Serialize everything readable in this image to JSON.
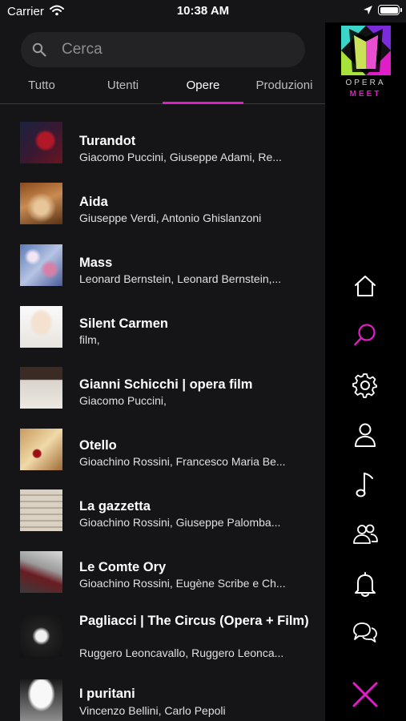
{
  "status_bar": {
    "carrier": "Carrier",
    "time": "10:38 AM"
  },
  "search": {
    "placeholder": "Cerca"
  },
  "tabs": [
    {
      "label": "Tutto"
    },
    {
      "label": "Utenti"
    },
    {
      "label": "Opere",
      "selected": true
    },
    {
      "label": "Produzioni"
    }
  ],
  "results": [
    {
      "title": "Turandot",
      "subtitle": "Giacomo Puccini, Giuseppe Adami, Re..."
    },
    {
      "title": "Aida",
      "subtitle": "Giuseppe Verdi, Antonio Ghislanzoni"
    },
    {
      "title": "Mass",
      "subtitle": "Leonard Bernstein, Leonard Bernstein,..."
    },
    {
      "title": "Silent Carmen",
      "subtitle": "film,"
    },
    {
      "title": "Gianni Schicchi | opera film",
      "subtitle": "Giacomo Puccini,"
    },
    {
      "title": "Otello",
      "subtitle": "Gioachino Rossini, Francesco Maria Be..."
    },
    {
      "title": "La gazzetta",
      "subtitle": "Gioachino Rossini, Giuseppe Palomba..."
    },
    {
      "title": "Le Comte Ory",
      "subtitle": "Gioachino Rossini, Eugène Scribe e Ch..."
    },
    {
      "title": "Pagliacci | The Circus (Opera + Film)",
      "subtitle": "Ruggero Leoncavallo, Ruggero Leonca..."
    },
    {
      "title": "I puritani",
      "subtitle": "Vincenzo Bellini, Carlo Pepoli"
    }
  ],
  "sidebar": {
    "logo_line1": "OPERA",
    "logo_line2": "MEET",
    "items": [
      {
        "icon": "home-icon"
      },
      {
        "icon": "search-icon",
        "active": true
      },
      {
        "icon": "gear-icon"
      },
      {
        "icon": "user-icon"
      },
      {
        "icon": "music-note-icon"
      },
      {
        "icon": "group-icon"
      },
      {
        "icon": "bell-icon"
      },
      {
        "icon": "chat-icon"
      },
      {
        "icon": "close-icon"
      }
    ]
  },
  "colors": {
    "accent": "#e01ec8",
    "background": "#151517",
    "sidebar": "#000000"
  }
}
